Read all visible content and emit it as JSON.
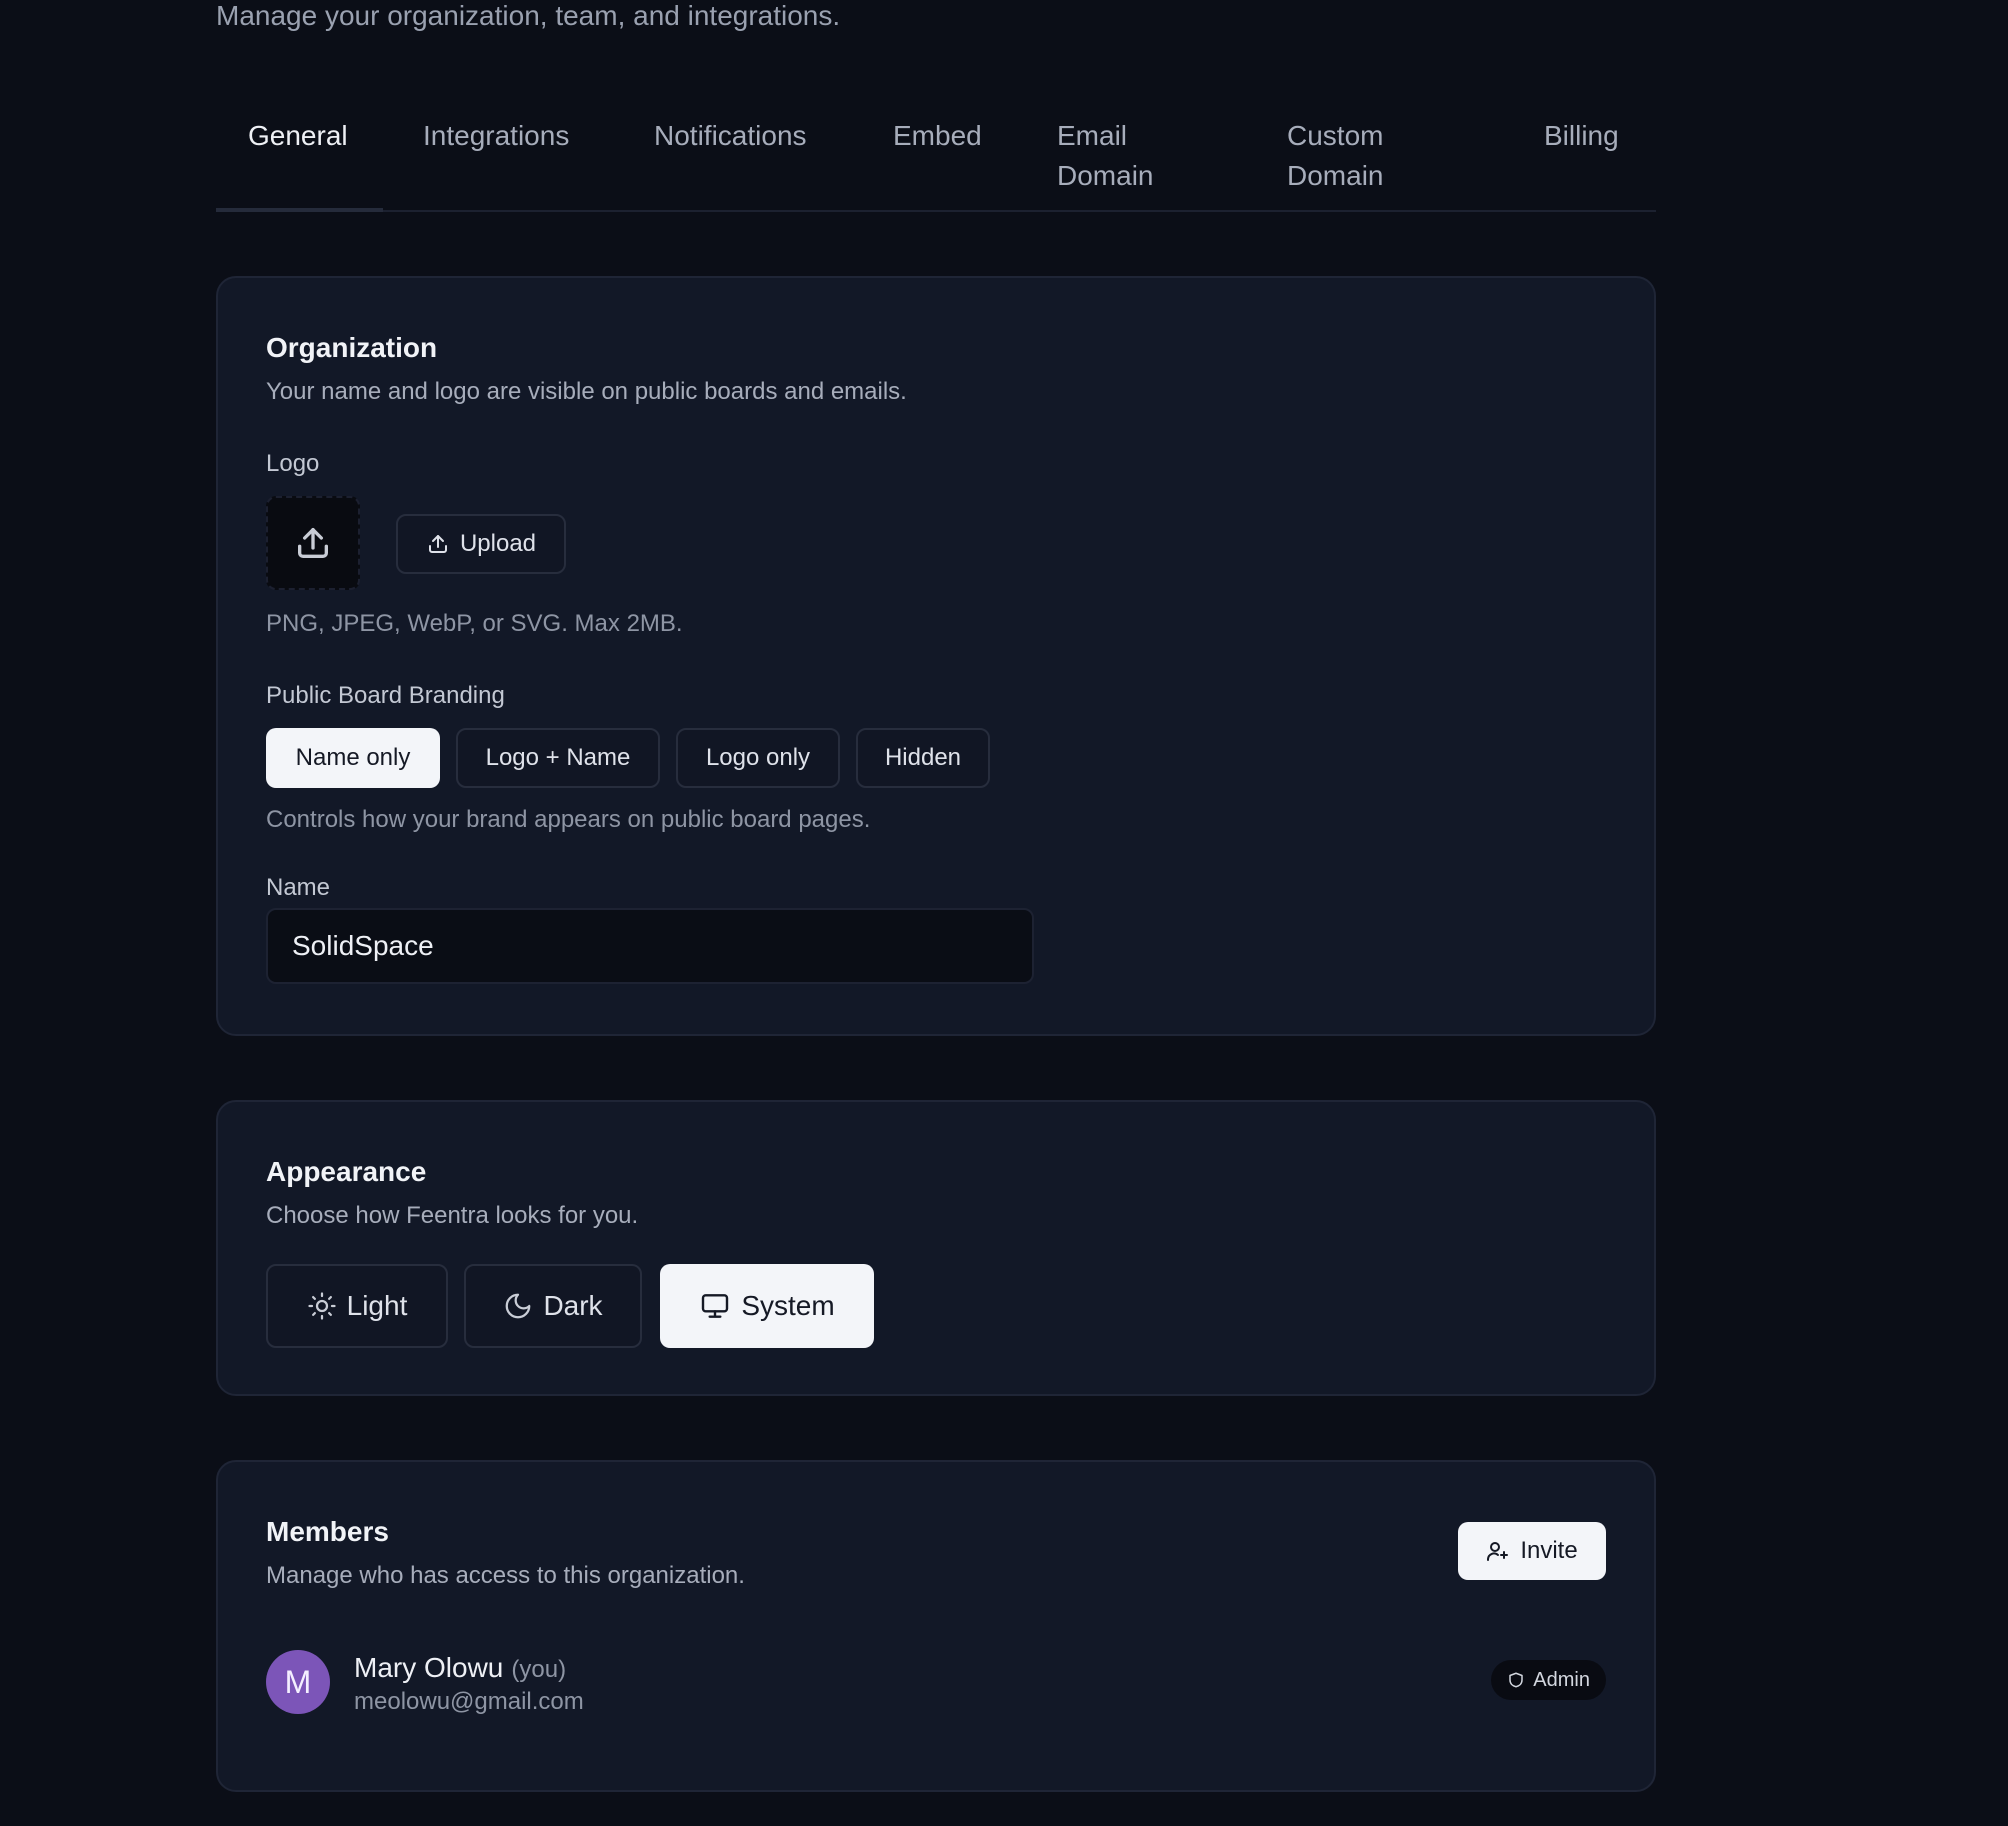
{
  "header": {
    "subtitle": "Manage your organization, team, and integrations."
  },
  "tabs": [
    {
      "label": "General"
    },
    {
      "label": "Integrations"
    },
    {
      "label": "Notifications"
    },
    {
      "label": "Embed"
    },
    {
      "label": "Email Domain"
    },
    {
      "label": "Custom Domain"
    },
    {
      "label": "Billing"
    }
  ],
  "active_tab": "General",
  "organization": {
    "title": "Organization",
    "description": "Your name and logo are visible on public boards and emails.",
    "logo_label": "Logo",
    "upload_label": "Upload",
    "logo_hint": "PNG, JPEG, WebP, or SVG. Max 2MB.",
    "branding_label": "Public Board Branding",
    "branding_options": [
      "Name only",
      "Logo + Name",
      "Logo only",
      "Hidden"
    ],
    "branding_selected": "Name only",
    "branding_hint": "Controls how your brand appears on public board pages.",
    "name_label": "Name",
    "name_value": "SolidSpace"
  },
  "appearance": {
    "title": "Appearance",
    "description": "Choose how Feentra looks for you.",
    "options": [
      {
        "label": "Light",
        "icon": "sun-icon"
      },
      {
        "label": "Dark",
        "icon": "moon-icon"
      },
      {
        "label": "System",
        "icon": "monitor-icon"
      }
    ],
    "selected": "System"
  },
  "members": {
    "title": "Members",
    "description": "Manage who has access to this organization.",
    "invite_label": "Invite",
    "list": [
      {
        "initial": "M",
        "name": "Mary Olowu",
        "you_tag": "(you)",
        "email": "meolowu@gmail.com",
        "role": "Admin",
        "avatar_color": "#7c55b8"
      }
    ]
  }
}
